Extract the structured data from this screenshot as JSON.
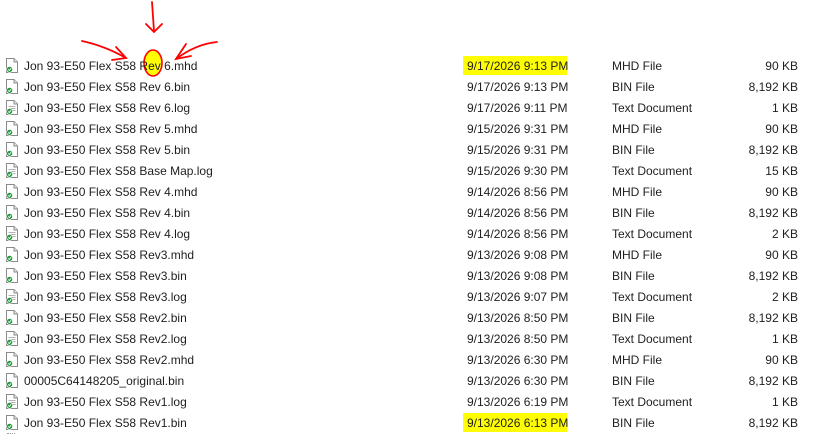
{
  "files": [
    {
      "name": "Jon 93-E50 Flex S58 Rev 6.mhd",
      "date": "9/17/2026 9:13 PM",
      "type": "MHD File",
      "size": "90 KB",
      "icon": "generic-file-icon",
      "highlight": true
    },
    {
      "name": "Jon 93-E50 Flex S58 Rev 6.bin",
      "date": "9/17/2026 9:13 PM",
      "type": "BIN File",
      "size": "8,192 KB",
      "icon": "generic-file-icon",
      "highlight": false
    },
    {
      "name": "Jon 93-E50 Flex S58 Rev 6.log",
      "date": "9/17/2026 9:11 PM",
      "type": "Text Document",
      "size": "1 KB",
      "icon": "text-document-icon",
      "highlight": false
    },
    {
      "name": "Jon 93-E50 Flex S58 Rev 5.mhd",
      "date": "9/15/2026 9:31 PM",
      "type": "MHD File",
      "size": "90 KB",
      "icon": "generic-file-icon",
      "highlight": false
    },
    {
      "name": "Jon 93-E50 Flex S58 Rev 5.bin",
      "date": "9/15/2026 9:31 PM",
      "type": "BIN File",
      "size": "8,192 KB",
      "icon": "generic-file-icon",
      "highlight": false
    },
    {
      "name": "Jon 93-E50 Flex S58 Base Map.log",
      "date": "9/15/2026 9:30 PM",
      "type": "Text Document",
      "size": "15 KB",
      "icon": "text-document-icon",
      "highlight": false
    },
    {
      "name": "Jon 93-E50 Flex S58 Rev 4.mhd",
      "date": "9/14/2026 8:56 PM",
      "type": "MHD File",
      "size": "90 KB",
      "icon": "generic-file-icon",
      "highlight": false
    },
    {
      "name": "Jon 93-E50 Flex S58 Rev 4.bin",
      "date": "9/14/2026 8:56 PM",
      "type": "BIN File",
      "size": "8,192 KB",
      "icon": "generic-file-icon",
      "highlight": false
    },
    {
      "name": "Jon 93-E50 Flex S58 Rev 4.log",
      "date": "9/14/2026 8:56 PM",
      "type": "Text Document",
      "size": "2 KB",
      "icon": "text-document-icon",
      "highlight": false
    },
    {
      "name": "Jon 93-E50 Flex S58 Rev3.mhd",
      "date": "9/13/2026 9:08 PM",
      "type": "MHD File",
      "size": "90 KB",
      "icon": "generic-file-icon",
      "highlight": false
    },
    {
      "name": "Jon 93-E50 Flex S58 Rev3.bin",
      "date": "9/13/2026 9:08 PM",
      "type": "BIN File",
      "size": "8,192 KB",
      "icon": "generic-file-icon",
      "highlight": false
    },
    {
      "name": "Jon 93-E50 Flex S58 Rev3.log",
      "date": "9/13/2026 9:07 PM",
      "type": "Text Document",
      "size": "2 KB",
      "icon": "text-document-icon",
      "highlight": false
    },
    {
      "name": "Jon 93-E50 Flex S58 Rev2.bin",
      "date": "9/13/2026 8:50 PM",
      "type": "BIN File",
      "size": "8,192 KB",
      "icon": "generic-file-icon",
      "highlight": false
    },
    {
      "name": "Jon 93-E50 Flex S58 Rev2.log",
      "date": "9/13/2026 8:50 PM",
      "type": "Text Document",
      "size": "1 KB",
      "icon": "text-document-icon",
      "highlight": false
    },
    {
      "name": "Jon 93-E50 Flex S58 Rev2.mhd",
      "date": "9/13/2026 6:30 PM",
      "type": "MHD File",
      "size": "90 KB",
      "icon": "generic-file-icon",
      "highlight": false
    },
    {
      "name": "00005C64148205_original.bin",
      "date": "9/13/2026 6:30 PM",
      "type": "BIN File",
      "size": "8,192 KB",
      "icon": "generic-file-icon",
      "highlight": false
    },
    {
      "name": "Jon 93-E50 Flex S58 Rev1.log",
      "date": "9/13/2026 6:19 PM",
      "type": "Text Document",
      "size": "1 KB",
      "icon": "text-document-icon",
      "highlight": false
    },
    {
      "name": "Jon 93-E50 Flex S58 Rev1.bin",
      "date": "9/13/2026 6:13 PM",
      "type": "BIN File",
      "size": "8,192 KB",
      "icon": "generic-file-icon",
      "highlight": true
    }
  ],
  "colors": {
    "highlight": "#ffff00",
    "annotation": "#ff0000",
    "badge": "#1e9e3c"
  },
  "annotation": {
    "arrows": 3,
    "circled_char": "6"
  }
}
